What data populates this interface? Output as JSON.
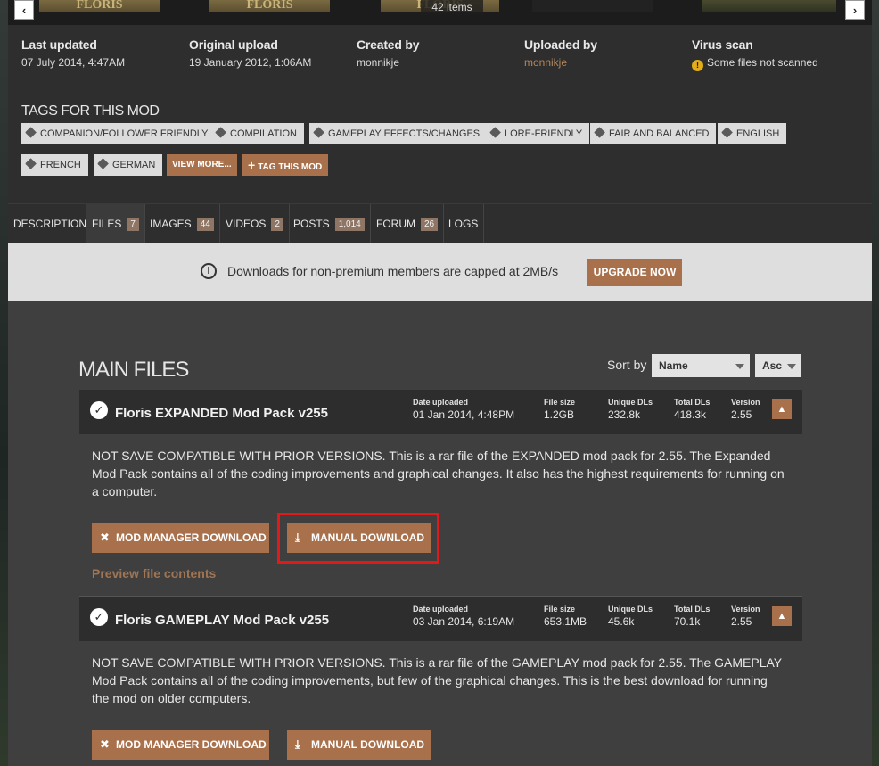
{
  "gallery": {
    "thumb_text": "FLORIS",
    "items_count": "42 items",
    "prev_icon": "chevron-left-icon",
    "next_icon": "chevron-right-icon"
  },
  "stats": [
    {
      "label": "Last updated",
      "value": "07 July 2014,  4:47AM"
    },
    {
      "label": "Original upload",
      "value": "19 January 2012,  1:06AM"
    },
    {
      "label": "Created by",
      "value": "monnikje"
    },
    {
      "label": "Uploaded by",
      "value": "monnikje"
    },
    {
      "label": "Virus scan",
      "value": "Some files not scanned"
    }
  ],
  "tags": {
    "title": "TAGS FOR THIS MOD",
    "items": [
      "COMPANION/FOLLOWER FRIENDLY",
      "COMPILATION",
      "GAMEPLAY EFFECTS/CHANGES",
      "LORE-FRIENDLY",
      "FAIR AND BALANCED",
      "ENGLISH",
      "FRENCH",
      "GERMAN"
    ],
    "view_more": "VIEW MORE...",
    "tag_this": "TAG THIS MOD"
  },
  "tabs": [
    {
      "label": "DESCRIPTION",
      "count": ""
    },
    {
      "label": "FILES",
      "count": "7"
    },
    {
      "label": "IMAGES",
      "count": "44"
    },
    {
      "label": "VIDEOS",
      "count": "2"
    },
    {
      "label": "POSTS",
      "count": "1,014"
    },
    {
      "label": "FORUM",
      "count": "26"
    },
    {
      "label": "LOGS",
      "count": ""
    }
  ],
  "banner": {
    "text": "Downloads for non-premium members are capped at 2MB/s",
    "upgrade": "UPGRADE NOW"
  },
  "files_section": {
    "title": "MAIN FILES",
    "sort_label": "Sort by",
    "sort_field": "Name",
    "sort_order": "Asc"
  },
  "stat_labels": {
    "date": "Date uploaded",
    "size": "File size",
    "unique": "Unique DLs",
    "total": "Total DLs",
    "version": "Version"
  },
  "files": [
    {
      "name": "Floris EXPANDED Mod Pack v255",
      "date": "01 Jan 2014, 4:48PM",
      "size": "1.2GB",
      "unique": "232.8k",
      "total": "418.3k",
      "version": "2.55",
      "description": "NOT SAVE COMPATIBLE WITH PRIOR VERSIONS. This is a rar file of the EXPANDED mod pack for 2.55. The Expanded Mod Pack contains all of the coding improvements and graphical changes. It also has the highest requirements for running on a computer.",
      "mod_manager": "MOD MANAGER DOWNLOAD",
      "manual": "MANUAL DOWNLOAD",
      "preview": "Preview file contents"
    },
    {
      "name": "Floris GAMEPLAY Mod Pack v255",
      "date": "03 Jan 2014, 6:19AM",
      "size": "653.1MB",
      "unique": "45.6k",
      "total": "70.1k",
      "version": "2.55",
      "description": "NOT SAVE COMPATIBLE WITH PRIOR VERSIONS. This is a rar file of the GAMEPLAY mod pack for 2.55. The GAMEPLAY Mod Pack contains all of the coding improvements, but few of the graphical changes. This is the best download for running the mod on older computers.",
      "mod_manager": "MOD MANAGER DOWNLOAD",
      "manual": "MANUAL DOWNLOAD"
    }
  ],
  "colors": {
    "accent": "#a9704c",
    "highlight": "#e11919"
  }
}
